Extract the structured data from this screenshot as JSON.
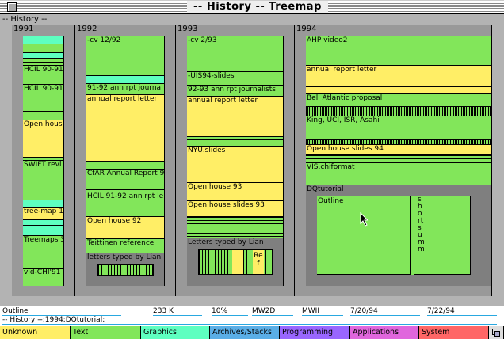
{
  "window": {
    "title": "-- History -- Treemap",
    "root_label": "-- History --"
  },
  "years": [
    {
      "label": "1991",
      "items": [
        "HCIL 90-91",
        "HCIL 90-91",
        "Open house",
        "SWIFT revi",
        "tree-map 1",
        "Treemaps 3",
        "vid-CHI'91"
      ]
    },
    {
      "label": "1992",
      "items": [
        "-cv  12/92",
        "91-92 ann rpt journa",
        "annual report letter",
        "CfAR Annual Report 9",
        "HCIL 91-92 ann rpt le",
        "Open house 92",
        "Teittinen reference",
        "letters typed by Lian"
      ]
    },
    {
      "label": "1993",
      "items": [
        "-cv  2/93",
        "-UIS94-slides",
        "92-93 ann rpt journalists",
        "annual report letter",
        "NYU.slides",
        "Open house 93",
        "Open house slides 93",
        "Letters typed by Lian",
        "Ref"
      ]
    },
    {
      "label": "1994",
      "items": [
        "AHP video2",
        "annual report letter",
        "Bell Atlantic proposal",
        "King, UCI, ISR, Asahi",
        "Open house slides 94",
        "VIS.chiformat",
        "DQtutorial",
        "Outline",
        "short summ"
      ]
    }
  ],
  "status": {
    "name": "Outline",
    "size": "233 K",
    "percent": "10%",
    "creator": "MW2D",
    "type": "MWII",
    "created": "7/20/94",
    "modified": "7/22/94",
    "path": "-- History --:1994:DQtutorial:"
  },
  "legend": [
    {
      "label": "Unknown",
      "color": "#ffee66"
    },
    {
      "label": "Text",
      "color": "#82e65a"
    },
    {
      "label": "Graphics",
      "color": "#5effc0"
    },
    {
      "label": "Archives/Stacks",
      "color": "#5aaee6"
    },
    {
      "label": "Programming",
      "color": "#9966ff"
    },
    {
      "label": "Applications",
      "color": "#e066dd"
    },
    {
      "label": "System",
      "color": "#ff6666"
    }
  ],
  "icons": {
    "close": "close-box-icon",
    "zoom": "zoom-box-icon",
    "cursor": "arrow-cursor-icon"
  }
}
